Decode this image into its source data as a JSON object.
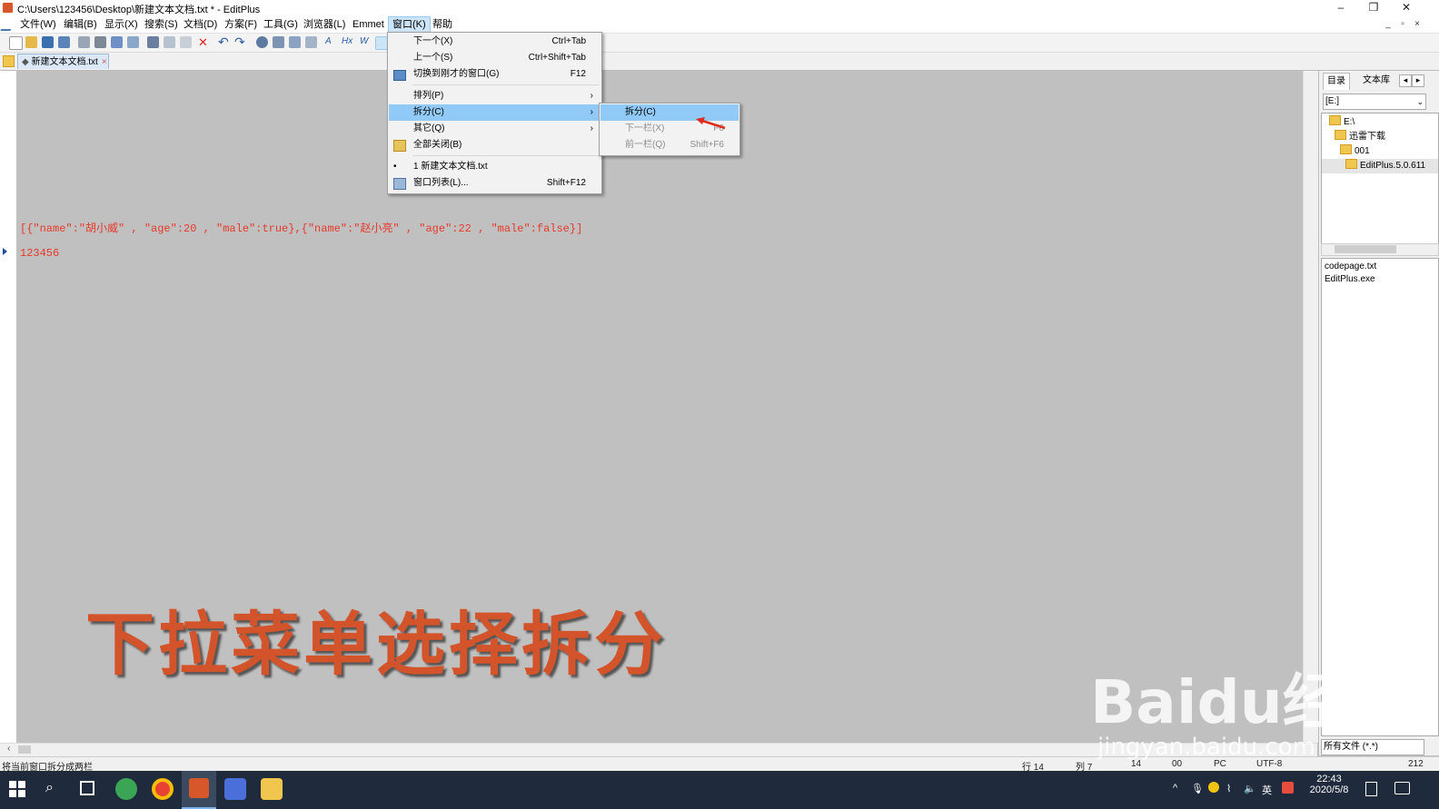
{
  "window": {
    "title": "C:\\Users\\123456\\Desktop\\新建文本文档.txt * - EditPlus"
  },
  "menubar": [
    "文件(W)",
    "编辑(B)",
    "显示(X)",
    "搜索(S)",
    "文档(D)",
    "方案(F)",
    "工具(G)",
    "浏览器(L)",
    "Emmet",
    "窗口(K)",
    "帮助"
  ],
  "active_menu": "窗口(K)",
  "tab": {
    "label": "新建文本文档.txt"
  },
  "editor": {
    "lines": [
      "[{\"name\":\"胡小威\" , \"age\":20 , \"male\":true},{\"name\":\"赵小亮\" , \"age\":22 , \"male\":false}]",
      "123456"
    ]
  },
  "window_menu": {
    "items": [
      {
        "label": "下一个(X)",
        "shortcut": "Ctrl+Tab"
      },
      {
        "label": "上一个(S)",
        "shortcut": "Ctrl+Shift+Tab"
      },
      {
        "label": "切换到刚才的窗口(G)",
        "shortcut": "F12"
      },
      {
        "label": "排列(P)",
        "shortcut": ""
      },
      {
        "label": "拆分(C)",
        "shortcut": ""
      },
      {
        "label": "其它(Q)",
        "shortcut": ""
      },
      {
        "label": "全部关闭(B)",
        "shortcut": ""
      },
      {
        "label": "1 新建文本文档.txt",
        "shortcut": ""
      },
      {
        "label": "窗口列表(L)...",
        "shortcut": "Shift+F12"
      }
    ]
  },
  "split_submenu": {
    "items": [
      {
        "label": "拆分(C)",
        "shortcut": ""
      },
      {
        "label": "下一栏(X)",
        "shortcut": "F6"
      },
      {
        "label": "前一栏(Q)",
        "shortcut": "Shift+F6"
      }
    ]
  },
  "right_panel": {
    "tabs": [
      "目录",
      "文本库"
    ],
    "drive": "[E:]",
    "tree": [
      "E:\\",
      "迅雷下载",
      "001",
      "EditPlus.5.0.611"
    ],
    "files": [
      "codepage.txt",
      "EditPlus.exe"
    ],
    "filter": "所有文件 (*.*)"
  },
  "statusbar": {
    "message": "将当前窗口拆分成两栏",
    "row": "行 14",
    "col": "列 7",
    "lines": "14",
    "enc_hex": "00",
    "mode": "PC",
    "encoding": "UTF-8",
    "size": "212"
  },
  "taskbar": {
    "ime": "英",
    "time": "22:43",
    "date": "2020/5/8"
  },
  "overlay": {
    "caption": "下拉菜单选择拆分",
    "watermark": "Baidu经验",
    "watermark_url": "jingyan.baidu.com"
  },
  "colors": {
    "accent": "#91c9f7",
    "code_text": "#e8392a",
    "caption": "#d3542b"
  }
}
